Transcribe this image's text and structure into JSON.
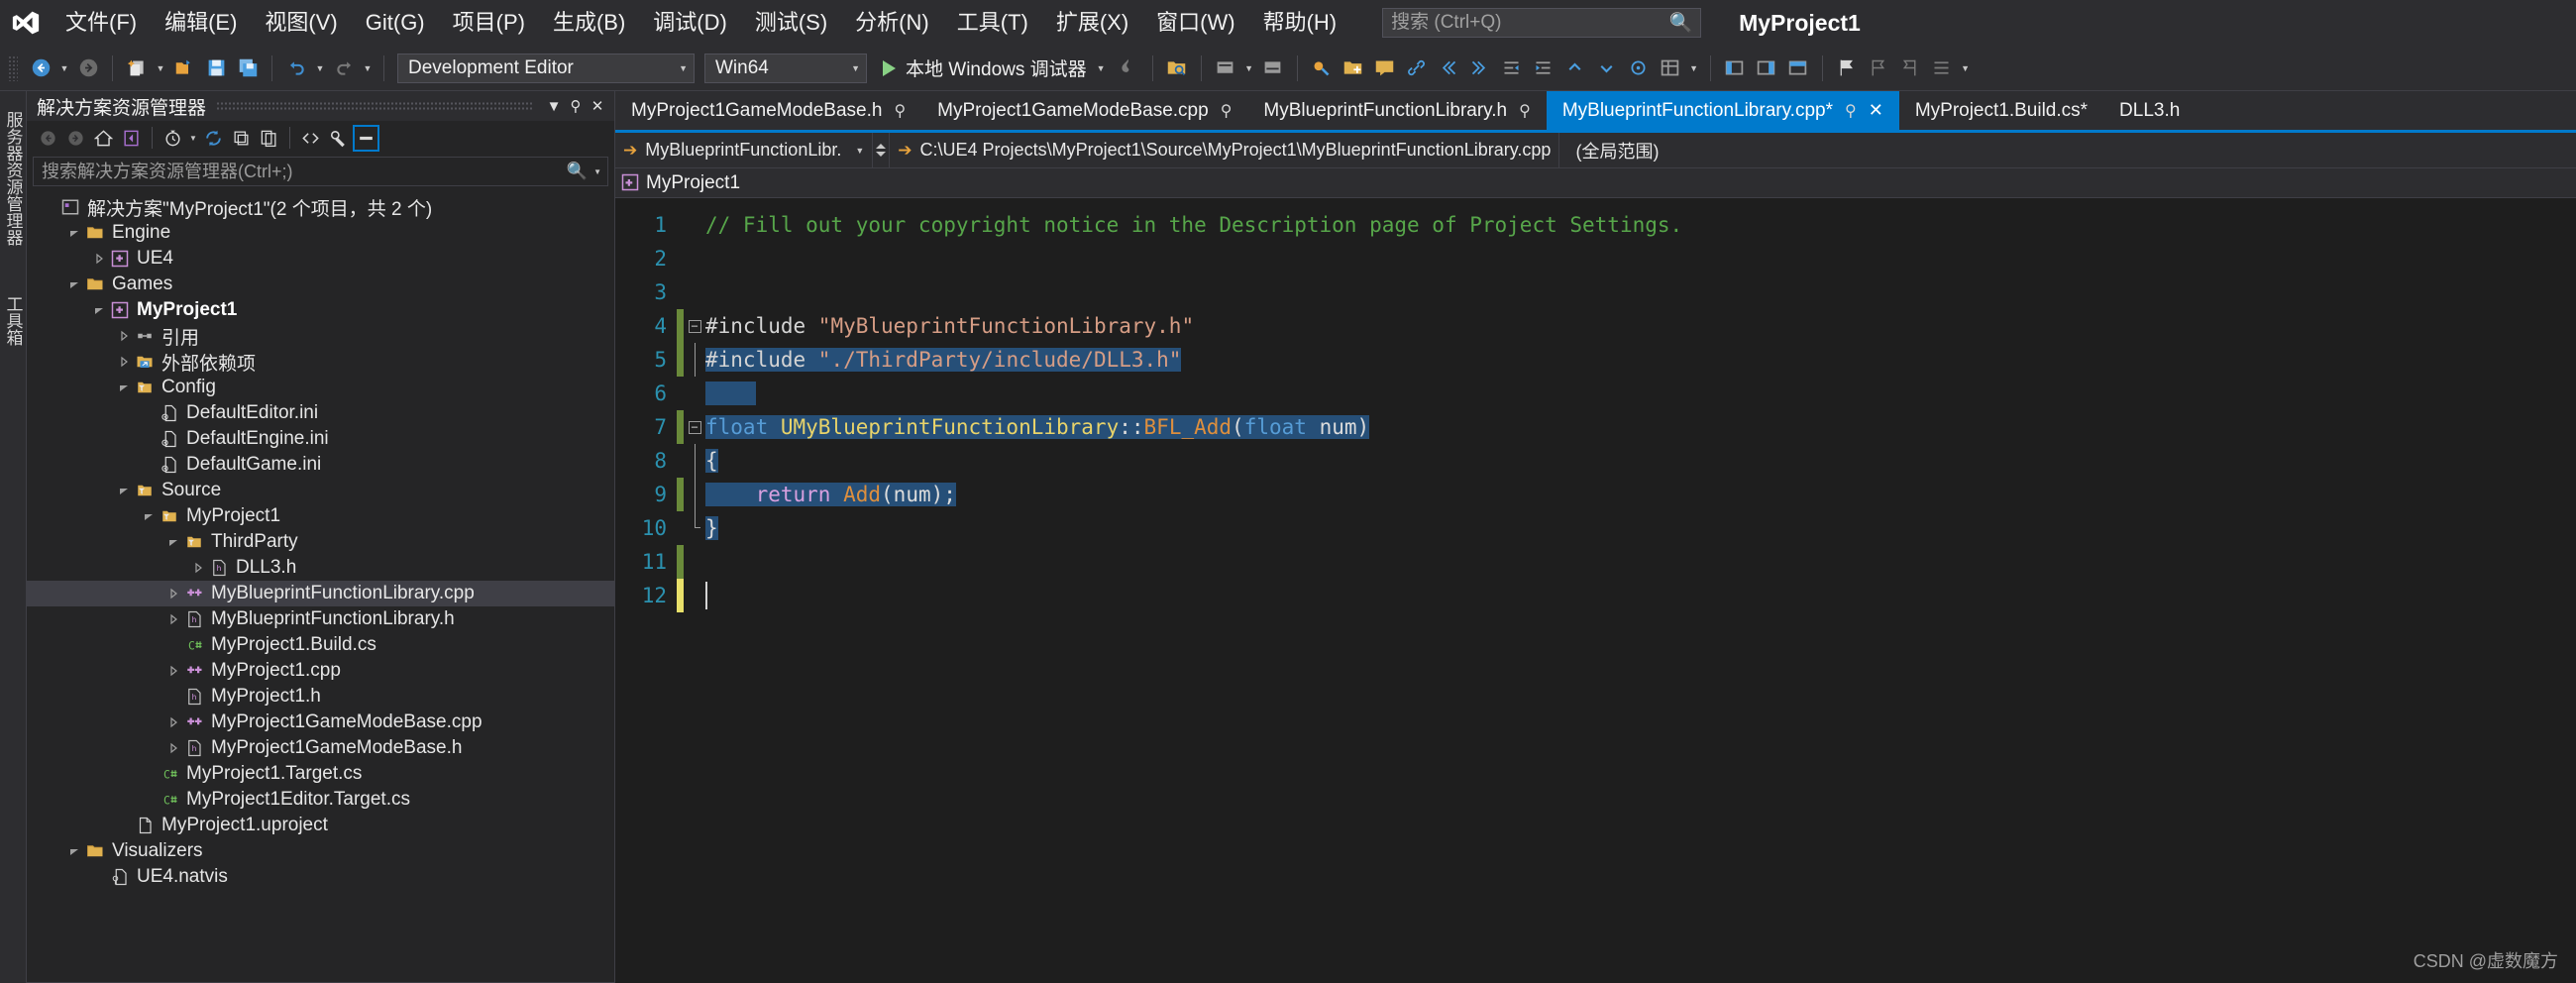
{
  "menu": {
    "logo_icon": "visual-studio-logo-icon",
    "items": [
      {
        "label": "文件(F)"
      },
      {
        "label": "编辑(E)"
      },
      {
        "label": "视图(V)"
      },
      {
        "label": "Git(G)"
      },
      {
        "label": "项目(P)"
      },
      {
        "label": "生成(B)"
      },
      {
        "label": "调试(D)"
      },
      {
        "label": "测试(S)"
      },
      {
        "label": "分析(N)"
      },
      {
        "label": "工具(T)"
      },
      {
        "label": "扩展(X)"
      },
      {
        "label": "窗口(W)"
      },
      {
        "label": "帮助(H)"
      }
    ],
    "search": {
      "value": "",
      "placeholder": "搜索 (Ctrl+Q)",
      "icon": "search-icon"
    },
    "project_title": "MyProject1"
  },
  "toolbar": {
    "nav_back_icon": "navigate-back-icon",
    "nav_forward_icon": "navigate-forward-icon",
    "new_item_icon": "new-item-icon",
    "open_file_icon": "open-file-icon",
    "save_icon": "save-icon",
    "save_all_icon": "save-all-icon",
    "undo_icon": "undo-icon",
    "redo_icon": "redo-icon",
    "config_combo": {
      "value": "Development Editor",
      "caret": "chevron-down-icon"
    },
    "platform_combo": {
      "value": "Win64",
      "caret": "chevron-down-icon"
    },
    "run_label": "本地 Windows 调试器",
    "run_icon": "play-triangle-icon",
    "hot_reload_icon": "hot-reload-icon",
    "right_icons": [
      "folder-search-icon",
      "step-icon-1",
      "step-icon-2",
      "bookmark-orange-icon",
      "add-folder-icon",
      "comment-icon",
      "link-icon",
      "left-arrow-icon",
      "right-arrow-icon",
      "outdent-icon",
      "indent-icon",
      "up-chevron-icon",
      "down-chevron-icon",
      "target-icon",
      "grid-icon",
      "panel-left-icon",
      "panel-right-icon",
      "panel-split-icon",
      "flag-icon",
      "flag-prev-icon",
      "flag-next-icon",
      "flag-list-icon"
    ]
  },
  "vertical_tabs": [
    {
      "label": "服务器资源管理器"
    },
    {
      "label": "工具箱"
    }
  ],
  "solution_explorer": {
    "title": "解决方案资源管理器",
    "header_buttons": [
      {
        "name": "dropdown-icon",
        "glyph": "▼"
      },
      {
        "name": "pin-icon",
        "glyph": "⚲"
      },
      {
        "name": "close-icon",
        "glyph": "✕"
      }
    ],
    "toolbar_icons": [
      "back-icon",
      "forward-icon",
      "home-icon",
      "vs-sync-icon",
      "pending-changes-icon",
      "refresh-icon",
      "collapse-all-icon",
      "show-all-files-icon",
      "code-view-icon",
      "properties-icon",
      "preview-selected-items-icon"
    ],
    "search": {
      "value": "",
      "placeholder": "搜索解决方案资源管理器(Ctrl+;)",
      "icon": "search-icon"
    },
    "tree": [
      {
        "label": "解决方案\"MyProject1\"(2 个项目，共 2 个)",
        "indent": 0,
        "twisty": "none",
        "icon": "solution-icon",
        "bold": false,
        "selected": false
      },
      {
        "label": "Engine",
        "indent": 1,
        "twisty": "expanded",
        "icon": "folder-icon",
        "bold": false,
        "selected": false
      },
      {
        "label": "UE4",
        "indent": 2,
        "twisty": "collapsed",
        "icon": "cpp-project-icon",
        "bold": false,
        "selected": false
      },
      {
        "label": "Games",
        "indent": 1,
        "twisty": "expanded",
        "icon": "folder-icon",
        "bold": false,
        "selected": false
      },
      {
        "label": "MyProject1",
        "indent": 2,
        "twisty": "expanded",
        "icon": "cpp-project-icon",
        "bold": true,
        "selected": false
      },
      {
        "label": "引用",
        "indent": 3,
        "twisty": "collapsed",
        "icon": "references-icon",
        "bold": false,
        "selected": false
      },
      {
        "label": "外部依赖项",
        "indent": 3,
        "twisty": "collapsed",
        "icon": "external-deps-icon",
        "bold": false,
        "selected": false
      },
      {
        "label": "Config",
        "indent": 3,
        "twisty": "expanded",
        "icon": "filter-folder-icon",
        "bold": false,
        "selected": false
      },
      {
        "label": "DefaultEditor.ini",
        "indent": 4,
        "twisty": "none",
        "icon": "ini-file-icon",
        "bold": false,
        "selected": false
      },
      {
        "label": "DefaultEngine.ini",
        "indent": 4,
        "twisty": "none",
        "icon": "ini-file-icon",
        "bold": false,
        "selected": false
      },
      {
        "label": "DefaultGame.ini",
        "indent": 4,
        "twisty": "none",
        "icon": "ini-file-icon",
        "bold": false,
        "selected": false
      },
      {
        "label": "Source",
        "indent": 3,
        "twisty": "expanded",
        "icon": "filter-folder-icon",
        "bold": false,
        "selected": false
      },
      {
        "label": "MyProject1",
        "indent": 4,
        "twisty": "expanded",
        "icon": "filter-folder-icon",
        "bold": false,
        "selected": false
      },
      {
        "label": "ThirdParty",
        "indent": 5,
        "twisty": "expanded",
        "icon": "filter-folder-icon",
        "bold": false,
        "selected": false
      },
      {
        "label": "DLL3.h",
        "indent": 6,
        "twisty": "collapsed",
        "icon": "h-file-icon",
        "bold": false,
        "selected": false
      },
      {
        "label": "MyBlueprintFunctionLibrary.cpp",
        "indent": 5,
        "twisty": "collapsed",
        "icon": "cpp-file-icon",
        "bold": false,
        "selected": true
      },
      {
        "label": "MyBlueprintFunctionLibrary.h",
        "indent": 5,
        "twisty": "collapsed",
        "icon": "h-file-icon",
        "bold": false,
        "selected": false
      },
      {
        "label": "MyProject1.Build.cs",
        "indent": 5,
        "twisty": "none",
        "icon": "cs-file-icon",
        "bold": false,
        "selected": false
      },
      {
        "label": "MyProject1.cpp",
        "indent": 5,
        "twisty": "collapsed",
        "icon": "cpp-file-icon",
        "bold": false,
        "selected": false
      },
      {
        "label": "MyProject1.h",
        "indent": 5,
        "twisty": "none",
        "icon": "h-file-icon",
        "bold": false,
        "selected": false
      },
      {
        "label": "MyProject1GameModeBase.cpp",
        "indent": 5,
        "twisty": "collapsed",
        "icon": "cpp-file-icon",
        "bold": false,
        "selected": false
      },
      {
        "label": "MyProject1GameModeBase.h",
        "indent": 5,
        "twisty": "collapsed",
        "icon": "h-file-icon",
        "bold": false,
        "selected": false
      },
      {
        "label": "MyProject1.Target.cs",
        "indent": 4,
        "twisty": "none",
        "icon": "cs-file-icon",
        "bold": false,
        "selected": false
      },
      {
        "label": "MyProject1Editor.Target.cs",
        "indent": 4,
        "twisty": "none",
        "icon": "cs-file-icon",
        "bold": false,
        "selected": false
      },
      {
        "label": "MyProject1.uproject",
        "indent": 3,
        "twisty": "none",
        "icon": "generic-file-icon",
        "bold": false,
        "selected": false
      },
      {
        "label": "Visualizers",
        "indent": 1,
        "twisty": "expanded",
        "icon": "folder-icon",
        "bold": false,
        "selected": false
      },
      {
        "label": "UE4.natvis",
        "indent": 2,
        "twisty": "none",
        "icon": "natvis-file-icon",
        "bold": false,
        "selected": false
      }
    ]
  },
  "editor": {
    "tabs": [
      {
        "label": "MyProject1GameModeBase.h",
        "pin": "⚲",
        "active": false,
        "closable": false
      },
      {
        "label": "MyProject1GameModeBase.cpp",
        "pin": "⚲",
        "active": false,
        "closable": false
      },
      {
        "label": "MyBlueprintFunctionLibrary.h",
        "pin": "⚲",
        "active": false,
        "closable": false
      },
      {
        "label": "MyBlueprintFunctionLibrary.cpp*",
        "pin": "⚲",
        "active": true,
        "closable": true,
        "close_glyph": "✕"
      },
      {
        "label": "MyProject1.Build.cs*",
        "pin": "",
        "active": false,
        "closable": false
      },
      {
        "label": "DLL3.h",
        "pin": "",
        "active": false,
        "closable": false
      }
    ],
    "navbar": {
      "project": "MyBlueprintFunctionLibr.",
      "path": "C:\\UE4 Projects\\MyProject1\\Source\\MyProject1\\MyBlueprintFunctionLibrary.cpp",
      "scope": "(全局范围)",
      "arrow_icon": "goto-arrow-icon"
    },
    "context_bar": {
      "label": "MyProject1",
      "icon": "cpp-project-icon"
    },
    "code": {
      "line_numbers": [
        1,
        2,
        3,
        4,
        5,
        6,
        7,
        8,
        9,
        10,
        11,
        12
      ],
      "lines": [
        {
          "n": 1,
          "tokens": [
            {
              "t": "// Fill out your copyright notice in the Description page of Project Settings.",
              "c": "comment"
            }
          ],
          "selected": false,
          "change": "none",
          "fold": "none"
        },
        {
          "n": 2,
          "tokens": [],
          "selected": false,
          "change": "none",
          "fold": "none"
        },
        {
          "n": 3,
          "tokens": [],
          "selected": false,
          "change": "none",
          "fold": "none"
        },
        {
          "n": 4,
          "tokens": [
            {
              "t": "#include ",
              "c": "pre"
            },
            {
              "t": "\"MyBlueprintFunctionLibrary.h\"",
              "c": "str"
            }
          ],
          "selected": false,
          "change": "green",
          "fold": "box"
        },
        {
          "n": 5,
          "tokens": [
            {
              "t": "#include ",
              "c": "pre"
            },
            {
              "t": "\"./ThirdParty/include/DLL3.h\"",
              "c": "str"
            }
          ],
          "selected": true,
          "change": "green",
          "fold": "line"
        },
        {
          "n": 6,
          "tokens": [],
          "selected": true,
          "change": "none",
          "fold": "none"
        },
        {
          "n": 7,
          "tokens": [
            {
              "t": "float ",
              "c": "kw"
            },
            {
              "t": "UMyBlueprintFunctionLibrary",
              "c": "cls"
            },
            {
              "t": "::",
              "c": "plain"
            },
            {
              "t": "BFL_Add",
              "c": "fn"
            },
            {
              "t": "(",
              "c": "plain"
            },
            {
              "t": "float ",
              "c": "kw"
            },
            {
              "t": "num",
              "c": "plain"
            },
            {
              "t": ")",
              "c": "plain"
            }
          ],
          "selected": true,
          "change": "green",
          "fold": "box"
        },
        {
          "n": 8,
          "tokens": [
            {
              "t": "{",
              "c": "plain"
            }
          ],
          "selected": true,
          "change": "none",
          "fold": "line"
        },
        {
          "n": 9,
          "tokens": [
            {
              "t": "    ",
              "c": "plain"
            },
            {
              "t": "return ",
              "c": "ctl"
            },
            {
              "t": "Add",
              "c": "fn"
            },
            {
              "t": "(num);",
              "c": "plain"
            }
          ],
          "selected": true,
          "change": "green",
          "fold": "line"
        },
        {
          "n": 10,
          "tokens": [
            {
              "t": "}",
              "c": "plain"
            }
          ],
          "selected": true,
          "change": "none",
          "fold": "end"
        },
        {
          "n": 11,
          "tokens": [],
          "selected": false,
          "change": "green",
          "fold": "none"
        },
        {
          "n": 12,
          "tokens": [],
          "selected": false,
          "change": "yellow",
          "fold": "none"
        }
      ]
    }
  },
  "watermark": "CSDN @虚数魔方",
  "colors": {
    "accent": "#007acc",
    "selection": "#264f78",
    "comment": "#57a64a",
    "string": "#d69d85",
    "keyword": "#569cd6",
    "class": "#e8d36a",
    "function": "#dd8f3e",
    "control": "#d8a0df",
    "line_number": "#2b91af",
    "bg_editor": "#1e1e1e",
    "bg_chrome": "#2d2d30",
    "bg_panel": "#252526"
  }
}
